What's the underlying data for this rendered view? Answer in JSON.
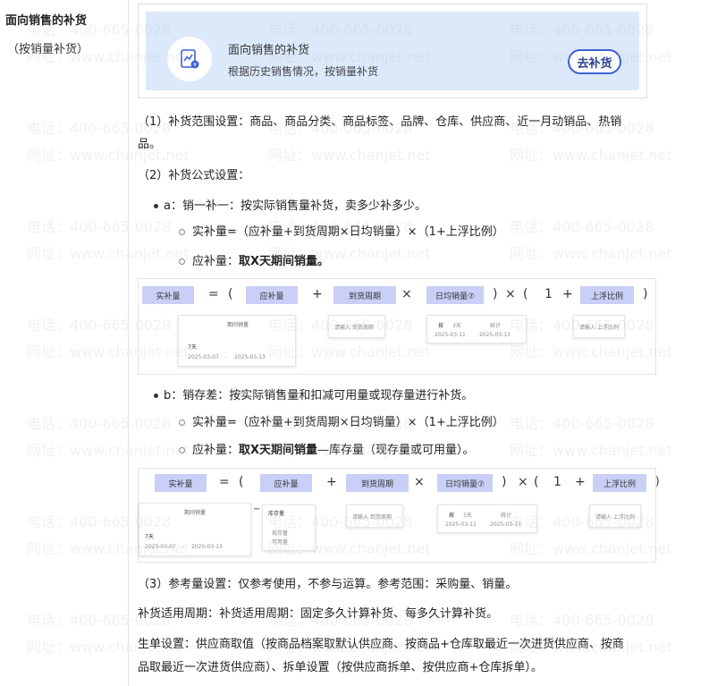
{
  "sidebar": {
    "title": "面向销售的补货",
    "subtitle": "（按销量补货）"
  },
  "banner": {
    "title": "面向销售的补货",
    "subtitle": "根据历史销售情况，按销量补货",
    "button_label": "去补货",
    "icon": "chart-clipboard-icon"
  },
  "content": {
    "p1_line1": "（1）补货范围设置：商品、商品分类、商品标签、品牌、仓库、供应商、近一月动销品、热销",
    "p1_line2": "品。",
    "p2": "（2）补货公式设置：",
    "a_title": "a：销一补一：按实际销售量补货，卖多少补多少。",
    "a_formula": "实补量=（应补量+到货周期×日均销量）×（1+上浮比例）",
    "a_should_prefix": "应补量：",
    "a_should_bold": "取X天期间销量。",
    "b_title": "b：销存差：按实际销售量和扣减可用量或现存量进行补货。",
    "b_formula": "实补量=（应补量+到货周期×日均销量）×（1+上浮比例）",
    "b_should_prefix": "应补量：",
    "b_should_bold": "取X天期间销量",
    "b_should_suffix": "—库存量（现存量或可用量）。",
    "p3": "（3）参考量设置：仅参考使用，不参与运算。参考范围：采购量、销量。",
    "p4": "补货适用周期：补货适用周期：固定多久计算补货、每多久计算补货。",
    "p5_line1": "生单设置：供应商取值（按商品档案取默认供应商、按商品+仓库取最近一次进货供应商、按商",
    "p5_line2": "品取最近一次进货供应商）、拆单设置（按供应商拆单、按供应商+仓库拆单）。"
  },
  "formula1": {
    "chips": [
      "实补量",
      "应补量",
      "到货周期",
      "日均销量⑦",
      "上浮比例"
    ],
    "ops": [
      "=",
      "(",
      "+",
      "×",
      ")",
      "×",
      "(",
      "1",
      "+",
      ")"
    ],
    "panel_label": "期间销量",
    "panel_value": "7天",
    "panel_from": "2025-03-07",
    "panel_sep": "-",
    "panel_to": "2025-03-13",
    "input1": "请输入 到货周期",
    "input2_check": "按",
    "input2_days": "3天",
    "input2_stat": "统计",
    "input2_from": "2025-03-11",
    "input2_to": "2025-03-13",
    "input3": "请输入 上浮比例"
  },
  "formula2": {
    "chips": [
      "实补量",
      "应补量",
      "到货周期",
      "日均销量⑦",
      "上浮比例"
    ],
    "ops": [
      "=",
      "(",
      "+",
      "×",
      ")",
      "×",
      "(",
      "1",
      "+",
      ")"
    ],
    "panel_label": "期间销量",
    "panel_value": "7天",
    "panel_from": "2025-03-07",
    "panel_sep": "-",
    "panel_to": "2025-03-13",
    "minus": "−",
    "stock_label": "库存量",
    "stock_opt1": "现存量",
    "stock_opt2": "可用量",
    "input1": "请输入 到货周期",
    "input2_check": "按",
    "input2_days": "3天",
    "input2_stat": "统计",
    "input2_from": "2025-03-11",
    "input2_to": "2025-03-13",
    "input3": "请输入 上浮比例"
  },
  "watermark": {
    "phone": "电话：400-665-0028",
    "site": "网址：www.chanjet.net"
  },
  "colors": {
    "banner_bg": "#dbe9fb",
    "chip_bg": "#c9cff6",
    "button_border": "#3b5fd6"
  }
}
